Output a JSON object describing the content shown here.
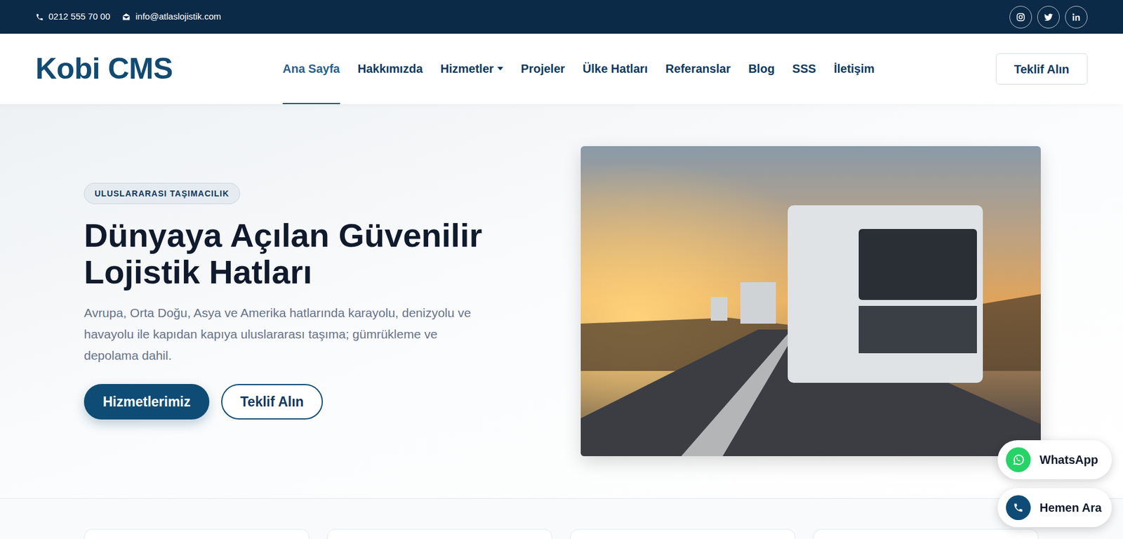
{
  "topbar": {
    "phone": "0212 555 70 00",
    "email": "info@atlaslojistik.com"
  },
  "nav": {
    "logo": "Kobi CMS",
    "items": [
      {
        "label": "Ana Sayfa",
        "selected": true,
        "has_dropdown": false
      },
      {
        "label": "Hakkımızda",
        "selected": false,
        "has_dropdown": false
      },
      {
        "label": "Hizmetler",
        "selected": false,
        "has_dropdown": true
      },
      {
        "label": "Projeler",
        "selected": false,
        "has_dropdown": false
      },
      {
        "label": "Ülke Hatları",
        "selected": false,
        "has_dropdown": false
      },
      {
        "label": "Referanslar",
        "selected": false,
        "has_dropdown": false
      },
      {
        "label": "Blog",
        "selected": false,
        "has_dropdown": false
      },
      {
        "label": "SSS",
        "selected": false,
        "has_dropdown": false
      },
      {
        "label": "İletişim",
        "selected": false,
        "has_dropdown": false
      }
    ],
    "cta": "Teklif Alın"
  },
  "hero": {
    "badge": "ULUSLARARASI TAŞIMACILIK",
    "title": "Dünyaya Açılan Güvenilir Lojistik Hatları",
    "description": "Avrupa, Orta Doğu, Asya ve Amerika hatlarında karayolu, denizyolu ve havayolu ile kapıdan kapıya uluslararası taşıma; gümrükleme ve depolama dahil.",
    "buttons": [
      {
        "label": "Hizmetlerimiz",
        "kind": "primary"
      },
      {
        "label": "Teklif Alın",
        "kind": "outline"
      }
    ]
  },
  "floating": [
    {
      "label": "WhatsApp",
      "kind": "whatsapp"
    },
    {
      "label": "Hemen Ara",
      "kind": "phone"
    }
  ]
}
